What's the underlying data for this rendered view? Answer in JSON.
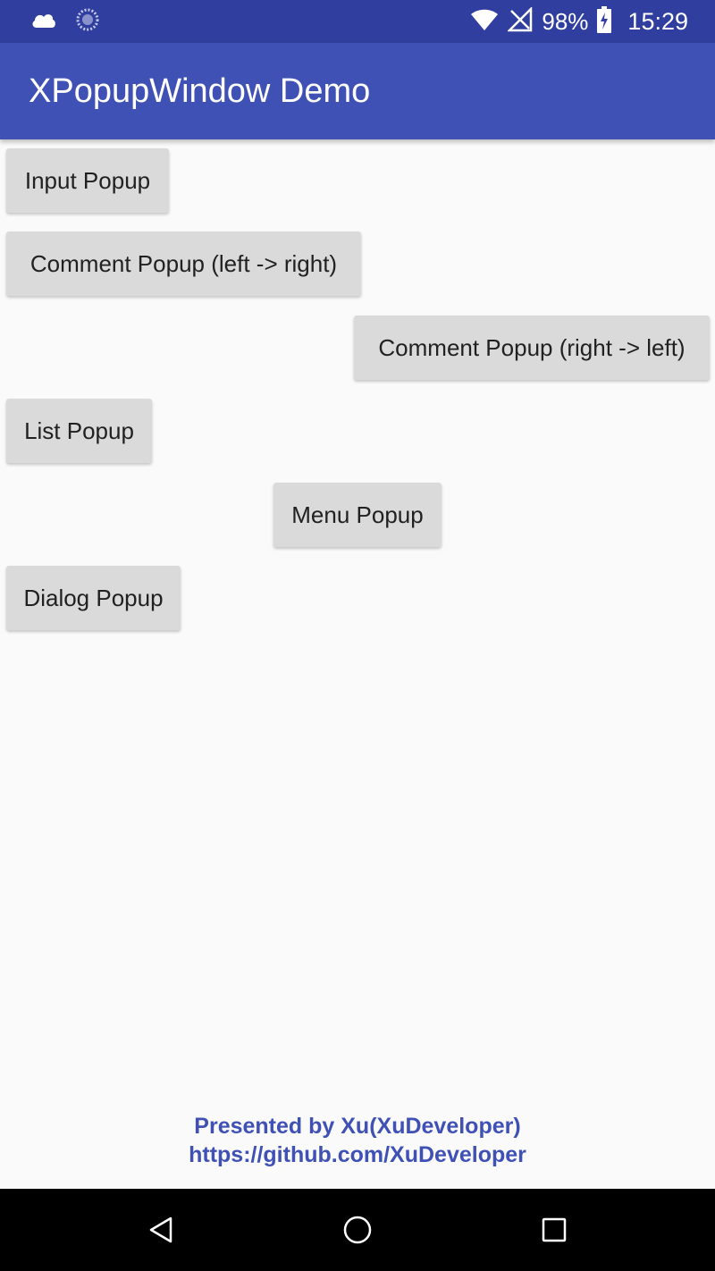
{
  "status_bar": {
    "battery_text": "98%",
    "time": "15:29",
    "icons": [
      "cloud-icon",
      "sync-icon",
      "wifi-icon",
      "no-signal-icon",
      "battery-icon"
    ]
  },
  "app_bar": {
    "title": "XPopupWindow Demo"
  },
  "buttons": {
    "input_popup": "Input Popup",
    "comment_left_right": "Comment Popup (left -> right)",
    "comment_right_left": "Comment Popup (right -> left)",
    "list_popup": "List Popup",
    "menu_popup": "Menu Popup",
    "dialog_popup": "Dialog Popup"
  },
  "footer": {
    "line1": "Presented by Xu(XuDeveloper)",
    "line2": "https://github.com/XuDeveloper"
  },
  "nav_bar": {
    "icons": [
      "back-icon",
      "home-icon",
      "recents-icon"
    ]
  },
  "colors": {
    "status_bar": "#303f9f",
    "primary": "#3f51b5",
    "button_bg": "#dadada",
    "background": "#fafafa",
    "nav_bar": "#000000"
  }
}
